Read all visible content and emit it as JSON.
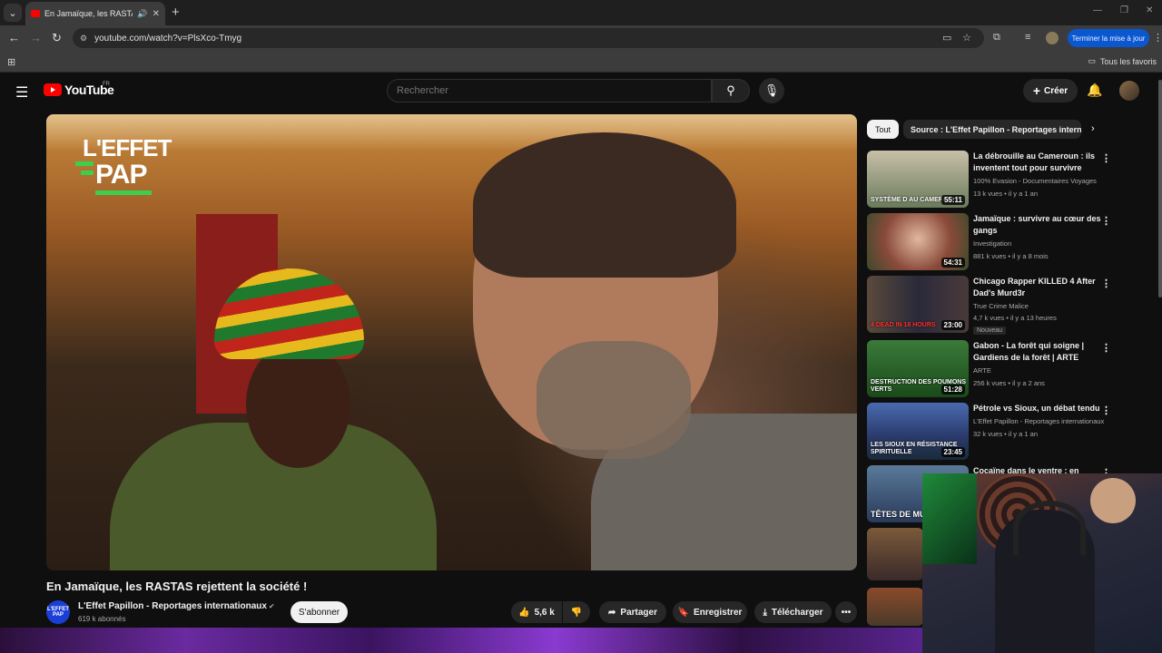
{
  "browser": {
    "tab_title": "En Jamaïque, les RASTAS rejettent la société !",
    "url": "youtube.com/watch?v=PlsXco-Tmyg",
    "update_label": "Terminer la mise à jour",
    "all_favorites": "Tous les favoris"
  },
  "masthead": {
    "logo_text": "YouTube",
    "country": "FR",
    "search_placeholder": "Rechercher",
    "create_label": "Créer"
  },
  "video": {
    "title": "En Jamaïque, les RASTAS rejettent la société !",
    "channel": "L'Effet Papillon - Reportages internationaux",
    "channel_avatar_text": "L'EFFET PAP",
    "subscribers": "619 k abonnés",
    "subscribe_label": "S'abonner",
    "likes": "5,6 k",
    "share_label": "Partager",
    "save_label": "Enregistrer",
    "download_label": "Télécharger",
    "overlay_logo_line1": "L'EFFET",
    "overlay_logo_line2": "PAP"
  },
  "sidebar": {
    "chips": [
      "Tout",
      "Source : L'Effet Papillon - Reportages internationaux"
    ],
    "items": [
      {
        "title": "La débrouille au Cameroun : ils inventent tout pour survivre",
        "channel": "100% Evasion - Documentaires Voyages",
        "meta": "13 k vues • il y a 1 an",
        "duration": "55:11",
        "caption": "SYSTÈME D AU CAMEROUN",
        "thumb_color": "#7a8a6a"
      },
      {
        "title": "Jamaïque : survivre au cœur des gangs",
        "channel": "Investigation",
        "meta": "881 k vues • il y a 8 mois",
        "duration": "54:31",
        "caption": "",
        "thumb_color": "#8a4a3a"
      },
      {
        "title": "Chicago Rapper KILLED 4 After Dad's Murd3r",
        "channel": "True Crime Malice",
        "meta": "4,7 k vues • il y a 13 heures",
        "duration": "23:00",
        "caption": "4 DEAD IN 16 HOURS",
        "badge": "Nouveau",
        "thumb_color": "#3a3a4a"
      },
      {
        "title": "Gabon - La forêt qui soigne | Gardiens de la forêt | ARTE",
        "channel": "ARTE",
        "meta": "256 k vues • il y a 2 ans",
        "duration": "51:28",
        "caption": "DESTRUCTION DES POUMONS VERTS",
        "thumb_color": "#2a5a2a"
      },
      {
        "title": "Pétrole vs Sioux, un débat tendu",
        "channel": "L'Effet Papillon - Reportages internationaux",
        "meta": "32 k vues • il y a 1 an",
        "duration": "23:45",
        "caption": "LES SIOUX EN RÉSISTANCE SPIRITUELLE",
        "thumb_color": "#2a4a8a"
      },
      {
        "title": "Cocaïne dans le ventre : en",
        "channel": "",
        "meta": "",
        "duration": "",
        "caption": "TÊTES DE MULES",
        "thumb_color": "#3a5a7a"
      }
    ]
  },
  "colors": {
    "youtube_red": "#ff0000",
    "subscribe_bg": "#f1f1f1",
    "update_button": "#0b57d0"
  }
}
